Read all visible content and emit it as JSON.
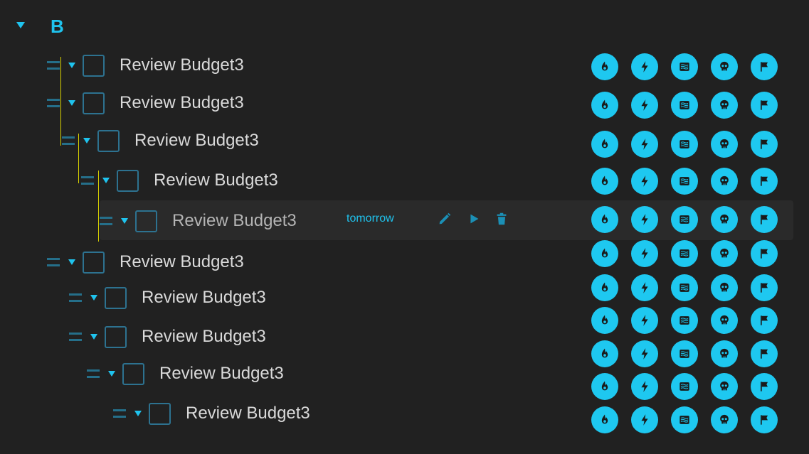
{
  "group": {
    "title": "B"
  },
  "tasks": [
    {
      "label": "Review Budget3"
    },
    {
      "label": "Review Budget3"
    },
    {
      "label": "Review Budget3"
    },
    {
      "label": "Review Budget3"
    },
    {
      "label": "Review Budget3",
      "due": "tomorrow"
    },
    {
      "label": "Review Budget3"
    },
    {
      "label": "Review Budget3"
    },
    {
      "label": "Review Budget3"
    },
    {
      "label": "Review Budget3"
    },
    {
      "label": "Review Budget3"
    }
  ],
  "task_actions": [
    "edit-icon",
    "play-icon",
    "trash-icon"
  ],
  "row_icons": [
    "flame-icon",
    "bolt-icon",
    "waves-icon",
    "skull-icon",
    "flag-icon"
  ],
  "colors": {
    "accent": "#1fc3ee",
    "icon_fill": "#1ec8f0",
    "background": "#212121",
    "guide_line": "#d8d100"
  }
}
